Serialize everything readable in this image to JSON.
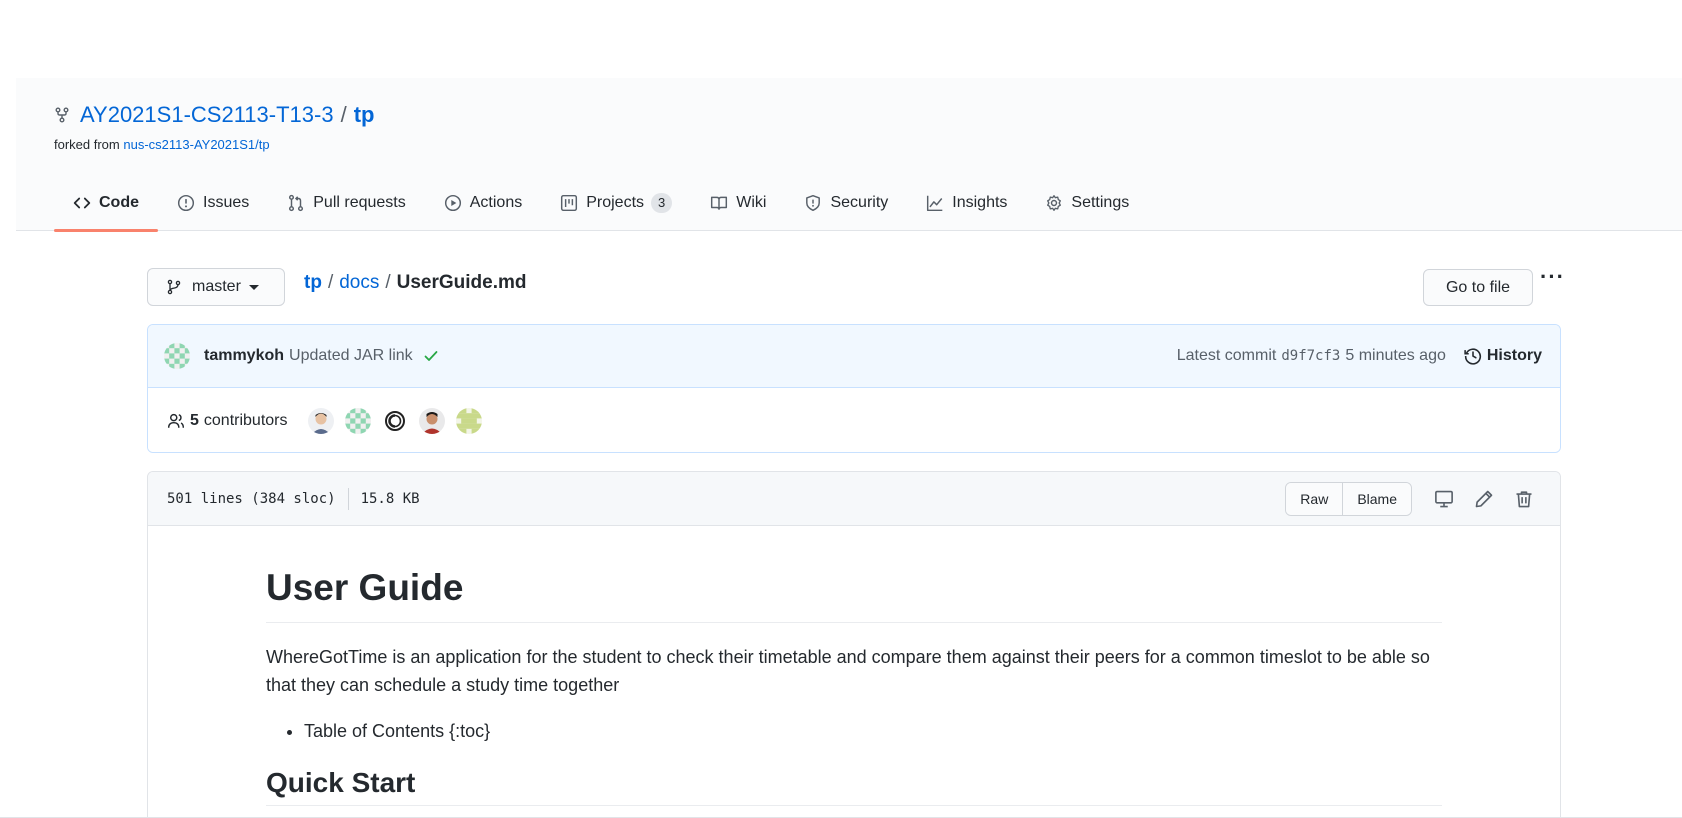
{
  "repo": {
    "owner": "AY2021S1-CS2113-T13-3",
    "separator": "/",
    "name": "tp",
    "forked_prefix": "forked from",
    "forked_from": "nus-cs2113-AY2021S1/tp"
  },
  "tabs": [
    {
      "label": "Code",
      "icon": "code-icon",
      "selected": true
    },
    {
      "label": "Issues",
      "icon": "issue-icon"
    },
    {
      "label": "Pull requests",
      "icon": "pull-request-icon"
    },
    {
      "label": "Actions",
      "icon": "play-icon"
    },
    {
      "label": "Projects",
      "icon": "project-icon",
      "count": "3"
    },
    {
      "label": "Wiki",
      "icon": "book-icon"
    },
    {
      "label": "Security",
      "icon": "shield-icon"
    },
    {
      "label": "Insights",
      "icon": "graph-icon"
    },
    {
      "label": "Settings",
      "icon": "gear-icon"
    }
  ],
  "branch": {
    "label": "master"
  },
  "breadcrumb": {
    "root": "tp",
    "folder": "docs",
    "file": "UserGuide.md",
    "sep": "/"
  },
  "actions": {
    "go_to_file": "Go to file",
    "more": "···"
  },
  "commit": {
    "author": "tammykoh",
    "message": "Updated JAR link",
    "latest_label": "Latest commit",
    "sha": "d9f7cf3",
    "time": "5 minutes ago",
    "history_label": "History"
  },
  "contributors": {
    "count": "5",
    "label": "contributors"
  },
  "file": {
    "lines": "501 lines (384 sloc)",
    "size": "15.8 KB",
    "raw_label": "Raw",
    "blame_label": "Blame"
  },
  "markdown": {
    "h1": "User Guide",
    "intro": "WhereGotTime is an application for the student to check their timetable and compare them against their peers for a common timeslot to be able so that they can schedule a study time together",
    "bullet": "Table of Contents {:toc}",
    "h2": "Quick Start"
  },
  "colors": {
    "link": "#0366d6",
    "tab_underline": "#f9826c",
    "commit_bg": "#f1f8ff",
    "check": "#28a745"
  }
}
